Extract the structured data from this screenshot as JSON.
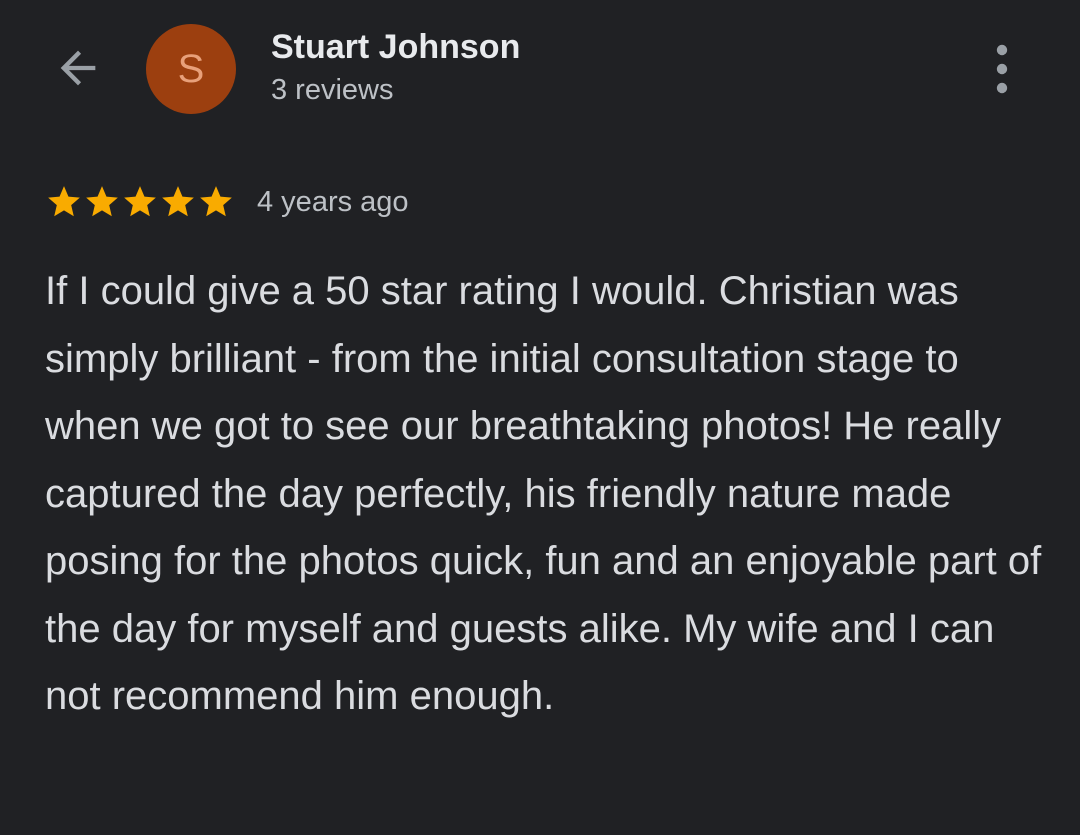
{
  "header": {
    "back_icon": "arrow-back-icon",
    "avatar": {
      "letter": "S",
      "color": "#9c3f0f",
      "text_color": "#e8a07a"
    },
    "reviewer_name": "Stuart Johnson",
    "review_count": "3 reviews",
    "more_icon": "more-vert-icon"
  },
  "review": {
    "rating": 5,
    "max_rating": 5,
    "star_icon": "star-icon",
    "star_color": "#f9ab00",
    "time": "4 years ago",
    "text": "If I could give a 50 star rating I would. Christian was simply brilliant - from the initial consultation stage to when we got to see our breathtaking photos! He really captured the day perfectly, his friendly nature made posing for the photos quick, fun and an enjoyable part of the day for myself and guests alike. My wife and I can not recommend him enough."
  },
  "colors": {
    "background": "#202124",
    "primary_text": "#e8eaed",
    "secondary_text": "#bdc1c6",
    "icon": "#9aa0a6"
  }
}
